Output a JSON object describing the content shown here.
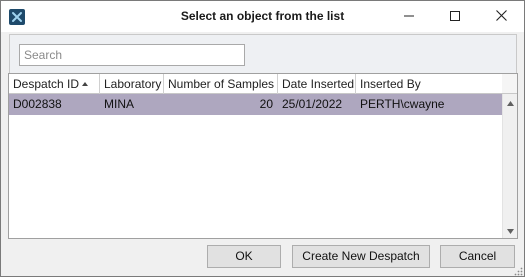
{
  "window": {
    "title": "Select an object from the list",
    "icon": "app-logo-icon",
    "controls": [
      "minimize-icon",
      "maximize-icon",
      "close-icon"
    ]
  },
  "search": {
    "placeholder": "Search",
    "value": ""
  },
  "grid": {
    "columns": [
      {
        "label": "Despatch ID",
        "sorted": "ascending"
      },
      {
        "label": "Laboratory"
      },
      {
        "label": "Number of Samples"
      },
      {
        "label": "Date Inserted"
      },
      {
        "label": "Inserted By"
      }
    ],
    "rows": [
      {
        "despatch_id": "D002838",
        "laboratory": "MINA",
        "number_of_samples": "20",
        "date_inserted": "25/01/2022",
        "inserted_by": "PERTH\\cwayne",
        "selected": true
      }
    ],
    "selection_color": "#aea7bf"
  },
  "buttons": {
    "ok": "OK",
    "create": "Create New Despatch",
    "cancel": "Cancel"
  }
}
